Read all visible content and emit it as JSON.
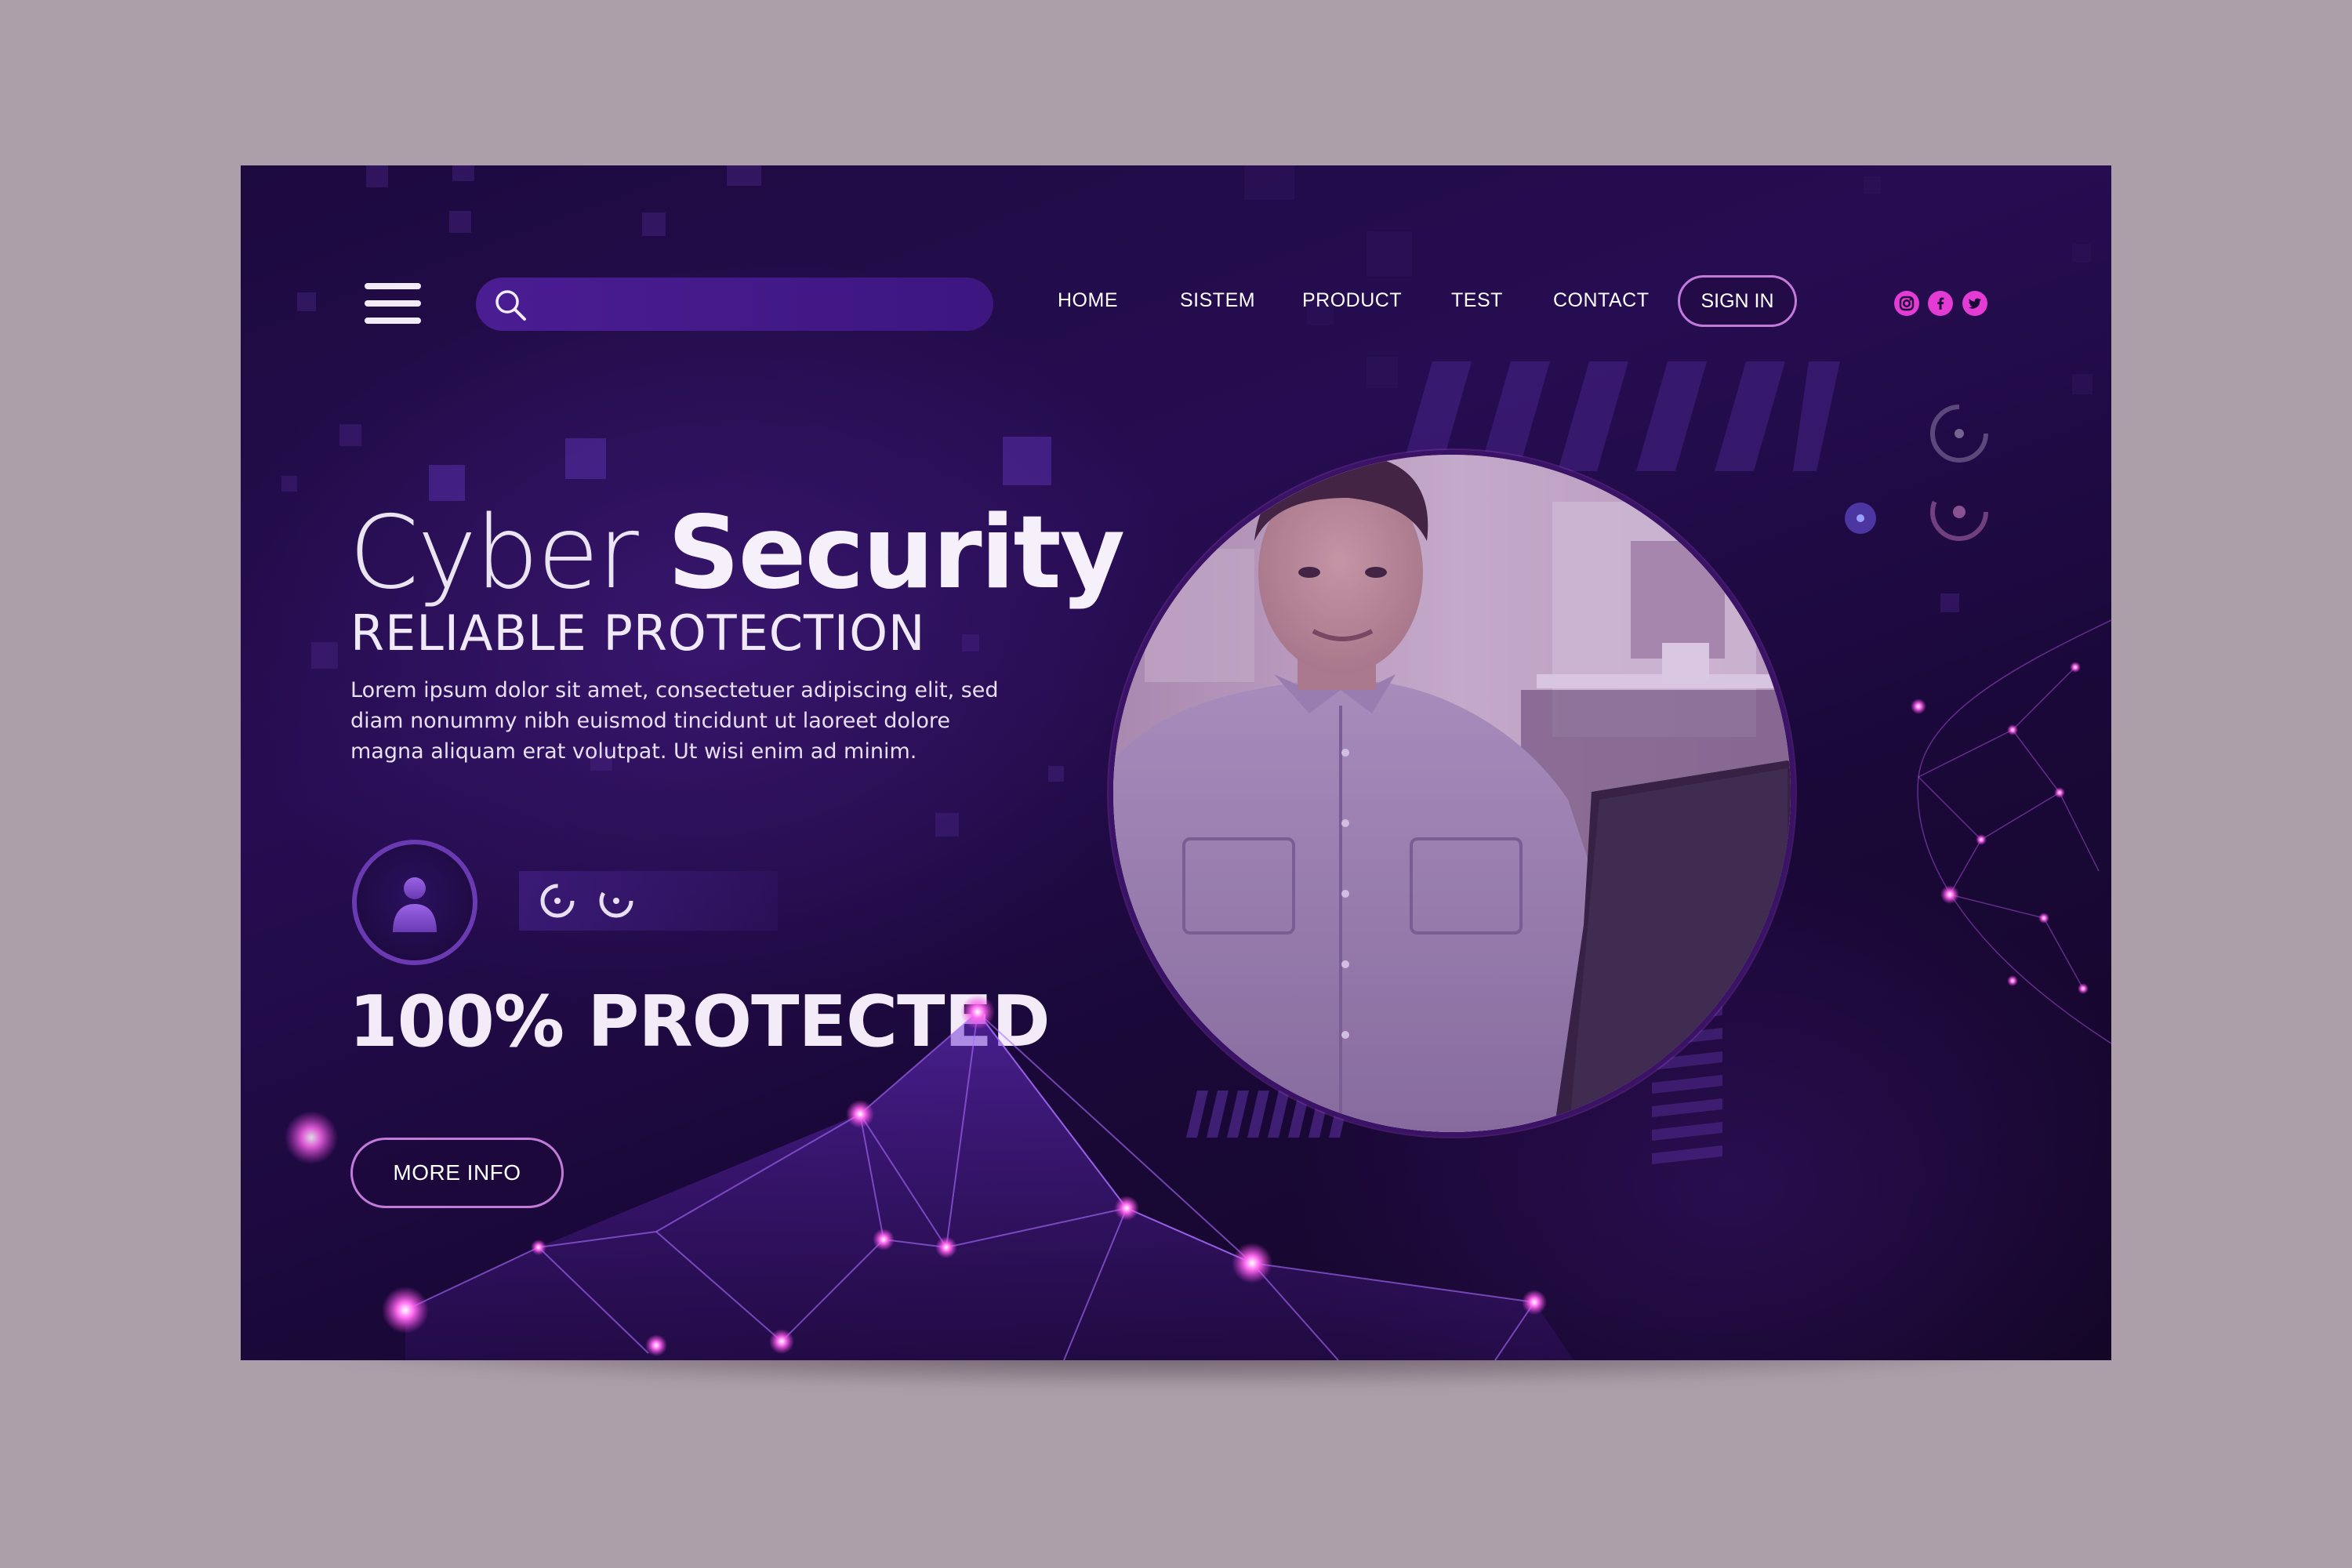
{
  "header": {
    "menu_icon": "hamburger-menu-icon",
    "search": {
      "placeholder": "",
      "icon": "search-icon"
    },
    "nav": [
      {
        "label": "HOME"
      },
      {
        "label": "SISTEM"
      },
      {
        "label": "PRODUCT"
      },
      {
        "label": "TEST"
      },
      {
        "label": "CONTACT"
      }
    ],
    "sign_in_label": "SIGN IN",
    "social": [
      "instagram-icon",
      "facebook-icon",
      "twitter-icon"
    ]
  },
  "hero": {
    "title_light": "Cyber",
    "title_bold": "Security",
    "subtitle": "RELIABLE PROTECTION",
    "body": "Lorem ipsum dolor sit amet, consectetuer adipiscing elit, sed diam nonummy nibh euismod tincidunt ut laoreet dolore magna aliquam erat volutpat. Ut wisi enim ad minim.",
    "protected_percent": "100%",
    "protected_label": "PROTECTED",
    "more_info_label": "MORE INFO"
  },
  "colors": {
    "background": "#ad9fa9",
    "page": "#1f0b44",
    "accent_pink": "#e33bd4",
    "button_border": "#c27bd9",
    "search_bar": "#4a1d93"
  }
}
